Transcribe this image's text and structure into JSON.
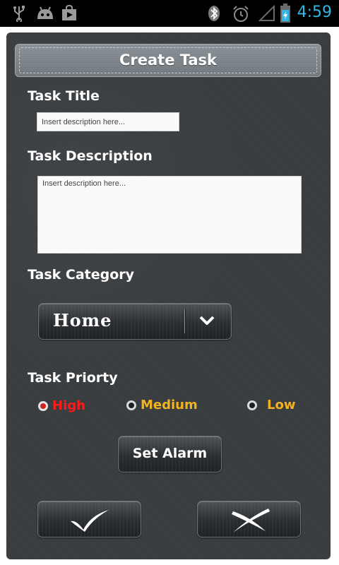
{
  "status_bar": {
    "time": "4:59",
    "icons": [
      "usb-icon",
      "android-icon",
      "play-store-icon",
      "bluetooth-icon",
      "alarm-icon",
      "signal-icon",
      "battery-icon"
    ],
    "clock_color": "#33b5e5"
  },
  "header": {
    "title": "Create Task"
  },
  "form": {
    "title_label": "Task Title",
    "title_placeholder": "Insert description here...",
    "description_label": "Task Description",
    "description_placeholder": "Insert description here...",
    "category_label": "Task Category",
    "category_selected": "Home",
    "priority_label": "Task Priorty",
    "priorities": [
      {
        "label": "High",
        "color": "#ff1a1a",
        "selected": true
      },
      {
        "label": "Medium",
        "color": "#f2b320",
        "selected": false
      },
      {
        "label": "Low",
        "color": "#f2b320",
        "selected": false
      }
    ],
    "alarm_button": "Set Alarm"
  },
  "actions": {
    "confirm_icon": "checkmark-icon",
    "cancel_icon": "close-icon"
  },
  "colors": {
    "panel_bg": "#3a3d40",
    "header_bg": "#7b8388",
    "high": "#ff1a1a",
    "medium_low": "#f2b320"
  }
}
